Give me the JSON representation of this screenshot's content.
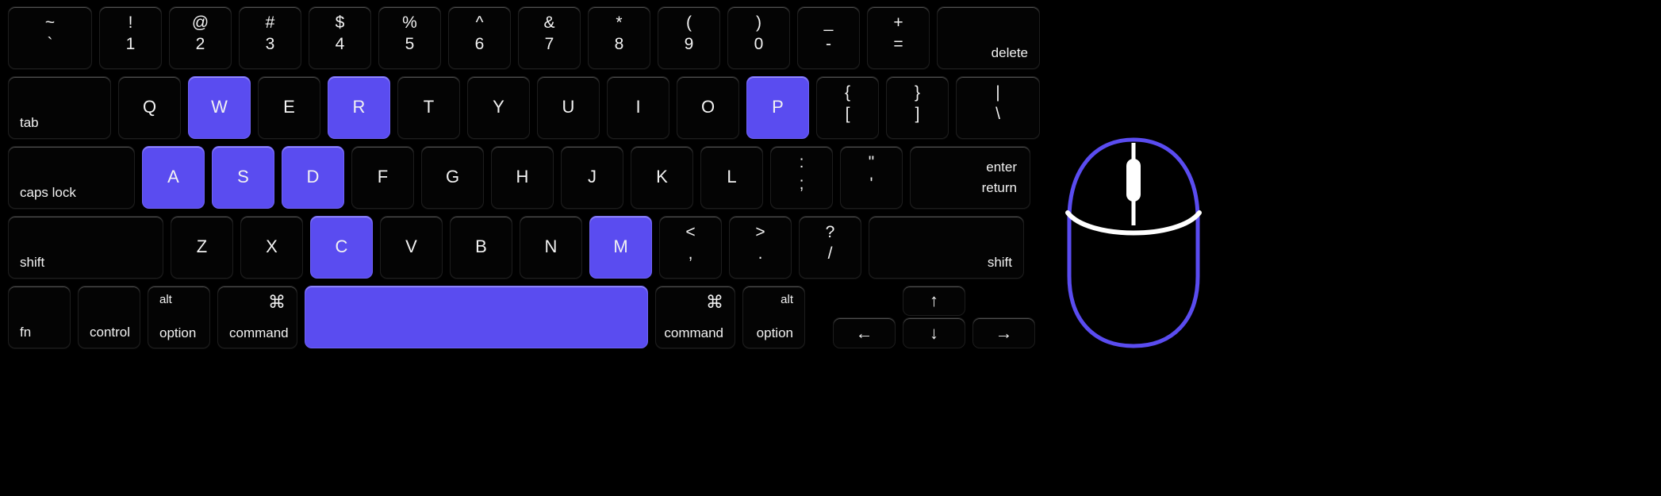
{
  "theme": {
    "background": "#000000",
    "key_fill": "#040404",
    "key_text": "#f2f2f2",
    "highlight": "#5a4cf0",
    "mouse_outline": "#5a4cf0",
    "mouse_detail": "#ffffff"
  },
  "keyboard": {
    "layout_name": "mac-ansi",
    "rows": [
      {
        "id": "number-row",
        "keys": [
          {
            "name": "tilde",
            "top": "~",
            "bottom": "`",
            "highlight": false
          },
          {
            "name": "one",
            "top": "!",
            "bottom": "1",
            "highlight": false
          },
          {
            "name": "two",
            "top": "@",
            "bottom": "2",
            "highlight": false
          },
          {
            "name": "three",
            "top": "#",
            "bottom": "3",
            "highlight": false
          },
          {
            "name": "four",
            "top": "$",
            "bottom": "4",
            "highlight": false
          },
          {
            "name": "five",
            "top": "%",
            "bottom": "5",
            "highlight": false
          },
          {
            "name": "six",
            "top": "^",
            "bottom": "6",
            "highlight": false
          },
          {
            "name": "seven",
            "top": "&",
            "bottom": "7",
            "highlight": false
          },
          {
            "name": "eight",
            "top": "*",
            "bottom": "8",
            "highlight": false
          },
          {
            "name": "nine",
            "top": "(",
            "bottom": "9",
            "highlight": false
          },
          {
            "name": "zero",
            "top": ")",
            "bottom": "0",
            "highlight": false
          },
          {
            "name": "minus",
            "top": "_",
            "bottom": "-",
            "highlight": false
          },
          {
            "name": "equals",
            "top": "+",
            "bottom": "=",
            "highlight": false
          },
          {
            "name": "delete",
            "label": "delete",
            "highlight": false
          }
        ]
      },
      {
        "id": "qwerty-row",
        "keys": [
          {
            "name": "tab",
            "label": "tab",
            "highlight": false
          },
          {
            "name": "q",
            "label": "Q",
            "highlight": false
          },
          {
            "name": "w",
            "label": "W",
            "highlight": true
          },
          {
            "name": "e",
            "label": "E",
            "highlight": false
          },
          {
            "name": "r",
            "label": "R",
            "highlight": true
          },
          {
            "name": "t",
            "label": "T",
            "highlight": false
          },
          {
            "name": "y",
            "label": "Y",
            "highlight": false
          },
          {
            "name": "u",
            "label": "U",
            "highlight": false
          },
          {
            "name": "i",
            "label": "I",
            "highlight": false
          },
          {
            "name": "o",
            "label": "O",
            "highlight": false
          },
          {
            "name": "p",
            "label": "P",
            "highlight": true
          },
          {
            "name": "bracket-left",
            "top": "{",
            "bottom": "[",
            "highlight": false
          },
          {
            "name": "bracket-right",
            "top": "}",
            "bottom": "]",
            "highlight": false
          },
          {
            "name": "backslash",
            "top": "|",
            "bottom": "\\",
            "highlight": false
          }
        ]
      },
      {
        "id": "home-row",
        "keys": [
          {
            "name": "caps-lock",
            "label": "caps lock",
            "highlight": false
          },
          {
            "name": "a",
            "label": "A",
            "highlight": true
          },
          {
            "name": "s",
            "label": "S",
            "highlight": true
          },
          {
            "name": "d",
            "label": "D",
            "highlight": true
          },
          {
            "name": "f",
            "label": "F",
            "highlight": false
          },
          {
            "name": "g",
            "label": "G",
            "highlight": false
          },
          {
            "name": "h",
            "label": "H",
            "highlight": false
          },
          {
            "name": "j",
            "label": "J",
            "highlight": false
          },
          {
            "name": "k",
            "label": "K",
            "highlight": false
          },
          {
            "name": "l",
            "label": "L",
            "highlight": false
          },
          {
            "name": "semicolon",
            "top": ":",
            "bottom": ";",
            "highlight": false
          },
          {
            "name": "quote",
            "top": "\"",
            "bottom": "'",
            "highlight": false
          },
          {
            "name": "return",
            "label_top": "enter",
            "label_bottom": "return",
            "highlight": false
          }
        ]
      },
      {
        "id": "shift-row",
        "keys": [
          {
            "name": "shift-left",
            "label": "shift",
            "highlight": false
          },
          {
            "name": "z",
            "label": "Z",
            "highlight": false
          },
          {
            "name": "x",
            "label": "X",
            "highlight": false
          },
          {
            "name": "c",
            "label": "C",
            "highlight": true
          },
          {
            "name": "v",
            "label": "V",
            "highlight": false
          },
          {
            "name": "b",
            "label": "B",
            "highlight": false
          },
          {
            "name": "n",
            "label": "N",
            "highlight": false
          },
          {
            "name": "m",
            "label": "M",
            "highlight": true
          },
          {
            "name": "comma",
            "top": "<",
            "bottom": ",",
            "highlight": false
          },
          {
            "name": "period",
            "top": ">",
            "bottom": ".",
            "highlight": false
          },
          {
            "name": "slash",
            "top": "?",
            "bottom": "/",
            "highlight": false
          },
          {
            "name": "shift-right",
            "label": "shift",
            "highlight": false
          }
        ]
      },
      {
        "id": "bottom-row",
        "keys": [
          {
            "name": "fn",
            "label": "fn",
            "highlight": false
          },
          {
            "name": "control",
            "label": "control",
            "highlight": false
          },
          {
            "name": "option-left",
            "symbol": "alt",
            "label": "option",
            "highlight": false
          },
          {
            "name": "command-left",
            "symbol": "⌘",
            "label": "command",
            "highlight": false
          },
          {
            "name": "space",
            "label": "",
            "highlight": true
          },
          {
            "name": "command-right",
            "symbol": "⌘",
            "label": "command",
            "highlight": false
          },
          {
            "name": "option-right",
            "symbol": "alt",
            "label": "option",
            "highlight": false
          }
        ]
      }
    ],
    "arrow_cluster": {
      "left": "←",
      "up": "↑",
      "down": "↓",
      "right": "→"
    }
  },
  "mouse": {
    "name": "mouse-device",
    "parts": {
      "body": "mouse-body",
      "left_button": "mouse-left-button",
      "right_button": "mouse-right-button",
      "scroll_wheel": "mouse-scroll-wheel"
    },
    "highlighted": false
  }
}
